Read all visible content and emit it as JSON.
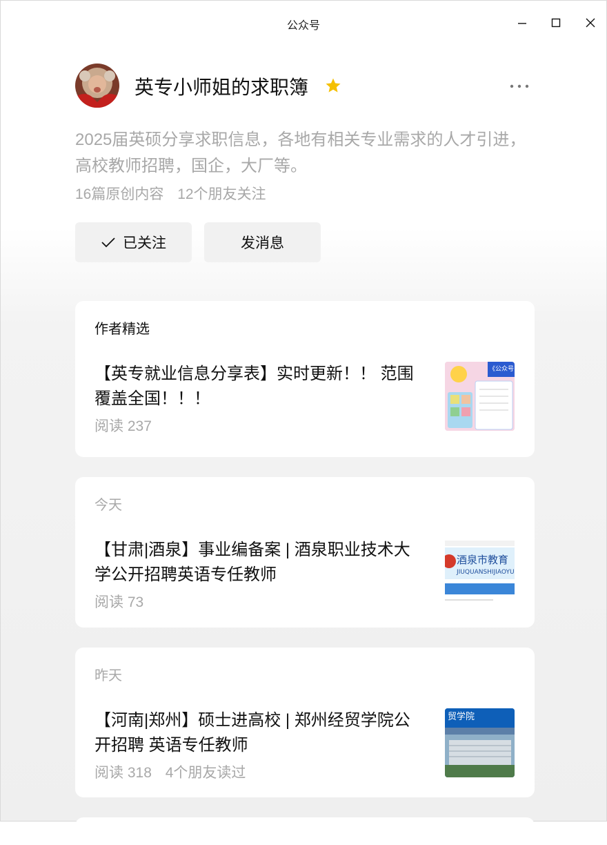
{
  "window": {
    "title": "公众号"
  },
  "account": {
    "name": "英专小师姐的求职簿",
    "description": "2025届英硕分享求职信息，各地有相关专业需求的人才引进，高校教师招聘，国企，大厂等。",
    "original_count": "16篇原创内容",
    "friends_following": "12个朋友关注"
  },
  "buttons": {
    "followed": "已关注",
    "message": "发消息"
  },
  "cards": [
    {
      "section": "作者精选",
      "title": "【英专就业信息分享表】实时更新！！ 范围覆盖全国！！！",
      "reads": "阅读 237",
      "friends": "",
      "thumb_text": "《公众号"
    },
    {
      "section": "今天",
      "title": "【甘肃|酒泉】事业编备案 | 酒泉职业技术大学公开招聘英语专任教师",
      "reads": "阅读 73",
      "friends": "",
      "thumb_text": "酒泉市教育",
      "thumb_sub": "JIUQUANSHIJIAOYU"
    },
    {
      "section": "昨天",
      "title": "【河南|郑州】硕士进高校 | 郑州经贸学院公开招聘 英语专任教师",
      "reads": "阅读 318",
      "friends": "4个朋友读过",
      "thumb_text": "贸学院"
    }
  ],
  "colors": {
    "star": "#f5c000",
    "button_bg": "#f1f1f1",
    "muted_text": "#a8a8a8"
  }
}
